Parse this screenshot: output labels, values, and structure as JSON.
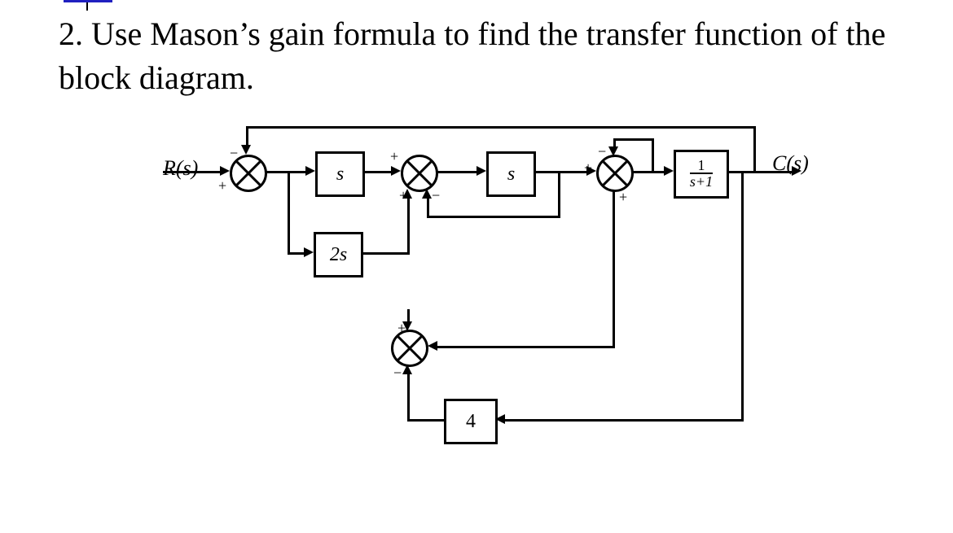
{
  "question": "2. Use Mason’s gain formula to find the transfer function of the block diagram.",
  "input_label": "R(s)",
  "output_label": "C(s)",
  "blocks": {
    "g1": "s",
    "g2": "s",
    "g3_num": "1",
    "g3_den": "s+1",
    "h1": "2s",
    "h2": "4"
  },
  "summers": {
    "s1": {
      "top_left": "−",
      "left": "+"
    },
    "s2": {
      "top_left": "+",
      "bottom_left": "+",
      "bottom_right": "−"
    },
    "s3": {
      "top_left": "−",
      "left": "+",
      "bottom": "+"
    },
    "s4": {
      "top_right": "+",
      "bottom_left": "−"
    }
  }
}
